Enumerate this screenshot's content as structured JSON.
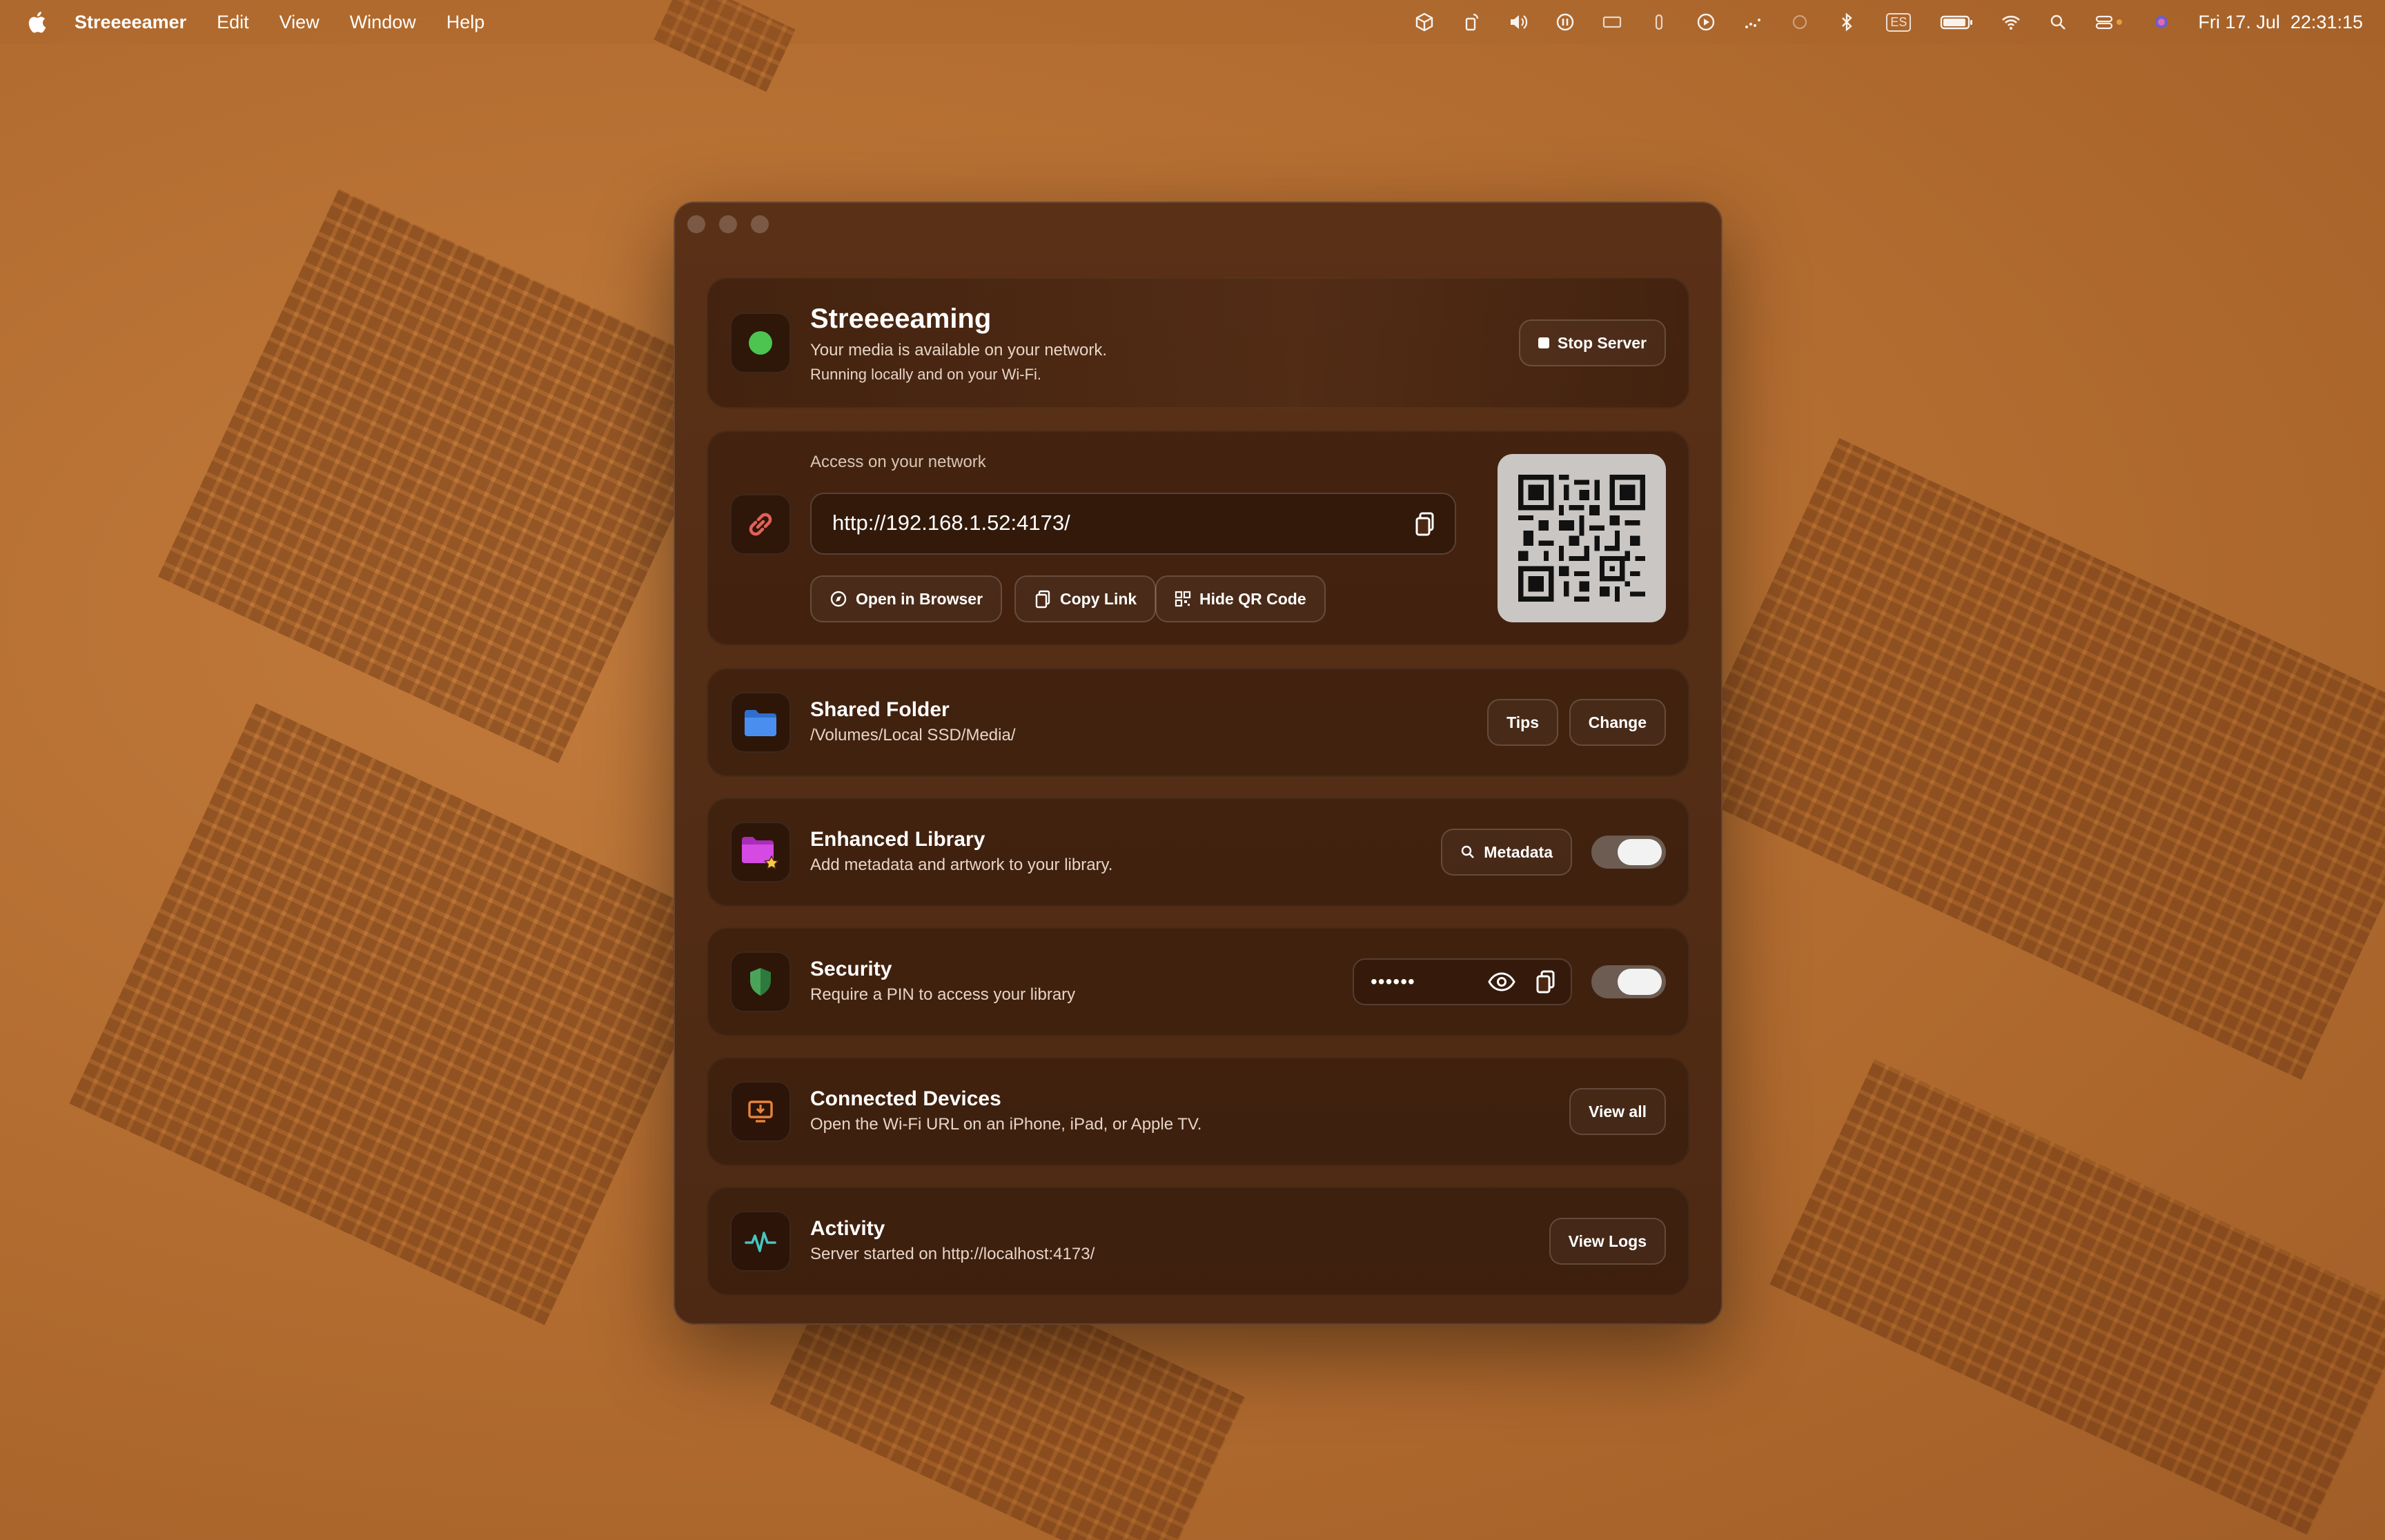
{
  "menubar": {
    "app_name": "Streeeeamer",
    "items": [
      "Edit",
      "View",
      "Window",
      "Help"
    ],
    "input_source": "ES",
    "datetime": "Fri 17. Jul  22:31:15"
  },
  "status_card": {
    "title": "Streeeeaming",
    "line1": "Your media is available on your network.",
    "line2": "Running locally and on your Wi-Fi.",
    "button": "Stop Server",
    "status_color": "#4cc44f"
  },
  "network_card": {
    "label": "Access on your network",
    "url": "http://192.168.1.52:4173/",
    "open_button": "Open in Browser",
    "copy_button": "Copy Link",
    "qr_button": "Hide QR Code"
  },
  "shared_folder": {
    "title": "Shared Folder",
    "path": "/Volumes/Local SSD/Media/",
    "tips_button": "Tips",
    "change_button": "Change"
  },
  "enhanced_library": {
    "title": "Enhanced Library",
    "subtitle": "Add metadata and artwork to your library.",
    "metadata_button": "Metadata",
    "enabled": true
  },
  "security": {
    "title": "Security",
    "subtitle": "Require a PIN to access your library",
    "pin_masked": "••••••",
    "enabled": true
  },
  "devices": {
    "title": "Connected Devices",
    "subtitle": "Open the Wi-Fi URL on an iPhone, iPad, or Apple TV.",
    "button": "View all"
  },
  "activity": {
    "title": "Activity",
    "subtitle": "Server started on http://localhost:4173/",
    "button": "View Logs"
  },
  "colors": {
    "accent_green": "#4cc44f",
    "link_red": "#e2605a",
    "folder_blue": "#3d86e8",
    "library_magenta": "#c63ad6",
    "shield_green": "#2e7a3c",
    "devices_orange": "#e8843c",
    "activity_teal": "#45c6c3"
  }
}
